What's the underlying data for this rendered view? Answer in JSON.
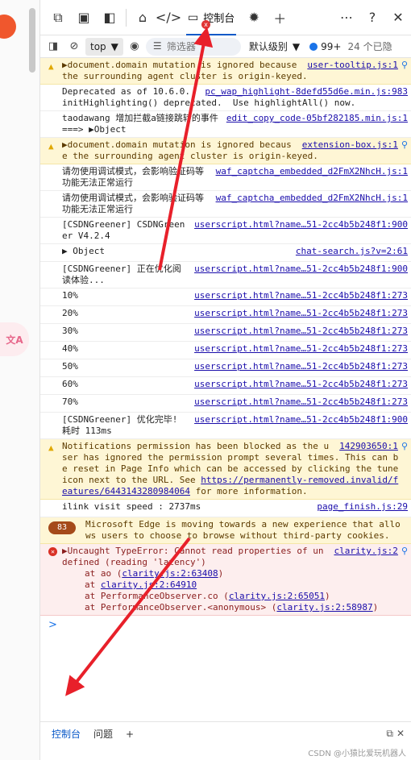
{
  "side": {
    "translate_label": "文A"
  },
  "tabs": {
    "console_label": "控制台",
    "err_badge": "x"
  },
  "toolbar": {
    "context": "top",
    "filter_placeholder": "筛选器",
    "level": "默认级别",
    "issues": "99+",
    "hidden": "24 个已隐"
  },
  "messages": [
    {
      "kind": "warn",
      "text": "▶document.domain mutation is ignored because the surrounding agent cluster is origin-keyed.",
      "src": "user-tooltip.js:1",
      "lens": true
    },
    {
      "kind": "log",
      "text": "Deprecated as of 10.6.0. initHighlighting() deprecated.  Use highlightAll() now.",
      "src": "pc_wap_highlight-8defd55d6e.min.js:983"
    },
    {
      "kind": "log",
      "text": "taodawang 增加拦截a链接跳转的事件 ===> ▶Object",
      "src": "edit_copy_code-05bf282185.min.js:1"
    },
    {
      "kind": "warn",
      "text": "▶document.domain mutation is ignored because the surrounding agent cluster is origin-keyed.",
      "src": "extension-box.js:1",
      "lens": true
    },
    {
      "kind": "log",
      "text": "请勿使用调试模式，会影响验证码等功能无法正常运行",
      "src": "waf_captcha_embedded_d2FmX2NhcH.js:1"
    },
    {
      "kind": "log",
      "text": "请勿使用调试模式，会影响验证码等功能无法正常运行",
      "src": "waf_captcha_embedded_d2FmX2NhcH.js:1"
    },
    {
      "kind": "log",
      "text": "[CSDNGreener] CSDNGreener V4.2.4",
      "src": "userscript.html?name…51-2cc4b5b248f1:900"
    },
    {
      "kind": "log",
      "text": "▶ Object",
      "src": "chat-search.js?v=2:61"
    },
    {
      "kind": "log",
      "text": "[CSDNGreener] 正在优化阅读体验...",
      "src": "userscript.html?name…51-2cc4b5b248f1:900"
    },
    {
      "kind": "log",
      "text": "10%",
      "src": "userscript.html?name…51-2cc4b5b248f1:273"
    },
    {
      "kind": "log",
      "text": "20%",
      "src": "userscript.html?name…51-2cc4b5b248f1:273"
    },
    {
      "kind": "log",
      "text": "30%",
      "src": "userscript.html?name…51-2cc4b5b248f1:273"
    },
    {
      "kind": "log",
      "text": "40%",
      "src": "userscript.html?name…51-2cc4b5b248f1:273"
    },
    {
      "kind": "log",
      "text": "50%",
      "src": "userscript.html?name…51-2cc4b5b248f1:273"
    },
    {
      "kind": "log",
      "text": "60%",
      "src": "userscript.html?name…51-2cc4b5b248f1:273"
    },
    {
      "kind": "log",
      "text": "70%",
      "src": "userscript.html?name…51-2cc4b5b248f1:273"
    },
    {
      "kind": "log",
      "text": "[CSDNGreener] 优化完毕! 耗时 113ms",
      "src": "userscript.html?name…51-2cc4b5b248f1:900"
    }
  ],
  "notif": {
    "text": "Notifications permission has been blocked as the user has ignored the permission prompt several times. This can be reset in Page Info which can be accessed by clicking the tune icon next to the URL. See",
    "link": "https://permanently-removed.invalid/features/6443143280984064",
    "tail": " for more information.",
    "src": "142903650:1"
  },
  "ilink": {
    "text": "ilink visit speed : 2737ms",
    "src": "page_finish.js:29"
  },
  "edge": {
    "badge": "83",
    "text": "Microsoft Edge is moving towards a new experience that allows users to choose to browse without third-party cookies."
  },
  "error": {
    "head": "▶Uncaught TypeError: Cannot read properties of undefined (reading 'latency')",
    "src": "clarity.js:2",
    "at1_pre": "at ao (",
    "at1_link": "clarity.js:2:63408",
    "at1_post": ")",
    "at2_pre": "at ",
    "at2_link": "clarity.js:2:64910",
    "at3_pre": "at PerformanceObserver.co (",
    "at3_link": "clarity.js:2:65051",
    "at3_post": ")",
    "at4_pre": "at PerformanceObserver.<anonymous> (",
    "at4_link": "clarity.js:2:58987",
    "at4_post": ")"
  },
  "prompt": ">",
  "drawer": {
    "console": "控制台",
    "issues": "问题",
    "add": "+"
  },
  "watermark": "CSDN @小猿比爱玩机器人"
}
